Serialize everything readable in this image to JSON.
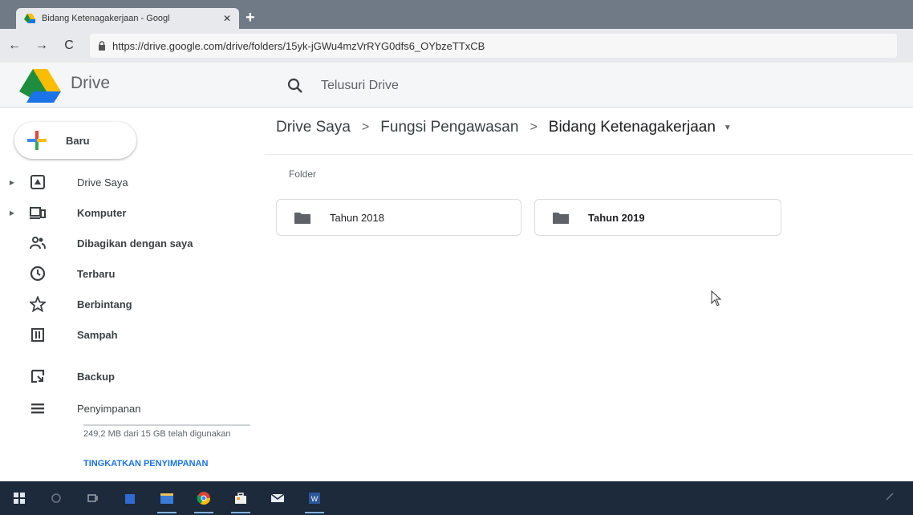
{
  "browser": {
    "tab_title": "Bidang Ketenagakerjaan - Googl",
    "tab_close": "✕",
    "new_tab": "+",
    "url": "https://drive.google.com/drive/folders/15yk-jGWu4mzVrRYG0dfs6_OYbzeTTxCB"
  },
  "header": {
    "brand": "Drive",
    "search_placeholder": "Telusuri Drive"
  },
  "sidebar": {
    "new_button": "Baru",
    "items": [
      {
        "label": "Drive Saya",
        "icon": "drive-icon",
        "expandable": true
      },
      {
        "label": "Komputer",
        "icon": "computer-icon",
        "expandable": true
      },
      {
        "label": "Dibagikan dengan saya",
        "icon": "shared-icon",
        "expandable": false
      },
      {
        "label": "Terbaru",
        "icon": "clock-icon",
        "expandable": false
      },
      {
        "label": "Berbintang",
        "icon": "star-icon",
        "expandable": false
      },
      {
        "label": "Sampah",
        "icon": "trash-icon",
        "expandable": false
      },
      {
        "label": "Backup",
        "icon": "backup-icon",
        "expandable": false
      },
      {
        "label": "Penyimpanan",
        "icon": "storage-icon",
        "expandable": false
      }
    ],
    "storage_text": "249,2 MB dari 15 GB telah digunakan",
    "storage_used_fraction": 0.016,
    "upgrade": "TINGKATKAN PENYIMPANAN"
  },
  "main": {
    "breadcrumb": [
      "Drive Saya",
      "Fungsi Pengawasan",
      "Bidang Ketenagakerjaan"
    ],
    "breadcrumb_separator": ">",
    "section_label": "Folder",
    "folders": [
      {
        "name": "Tahun 2018"
      },
      {
        "name": "Tahun 2019"
      }
    ]
  },
  "colors": {
    "accent": "#1a73e8",
    "taskbar": "#1c2a3b"
  }
}
